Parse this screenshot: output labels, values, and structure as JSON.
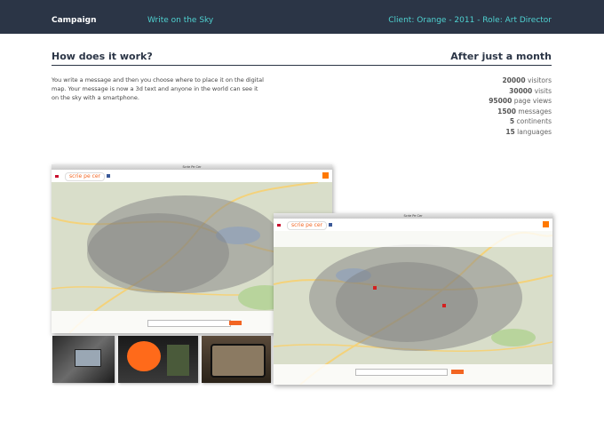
{
  "header": {
    "campaign_label": "Campaign",
    "project_title": "Write on the Sky",
    "client_info": "Client: Orange - 2011 - Role: Art Director"
  },
  "how": {
    "title": "How does it work?",
    "description": "You write a message and then you choose where to place it on the digital map. Your message is now a 3d text and anyone in the world can see it on the sky with a smartphone."
  },
  "results": {
    "title": "After just a month",
    "stats": [
      {
        "value": "20000",
        "label": "visitors"
      },
      {
        "value": "30000",
        "label": "visits"
      },
      {
        "value": "95000",
        "label": "page views"
      },
      {
        "value": "1500",
        "label": "messages"
      },
      {
        "value": "5",
        "label": "continents"
      },
      {
        "value": "15",
        "label": "languages"
      }
    ]
  },
  "screens": {
    "window_title": "Scrie Pe Cer",
    "logo_text": "scrie pe cer",
    "brand_color": "#ff7900"
  },
  "colors": {
    "header_bg": "#2b3546",
    "accent": "#4fd1d0"
  }
}
